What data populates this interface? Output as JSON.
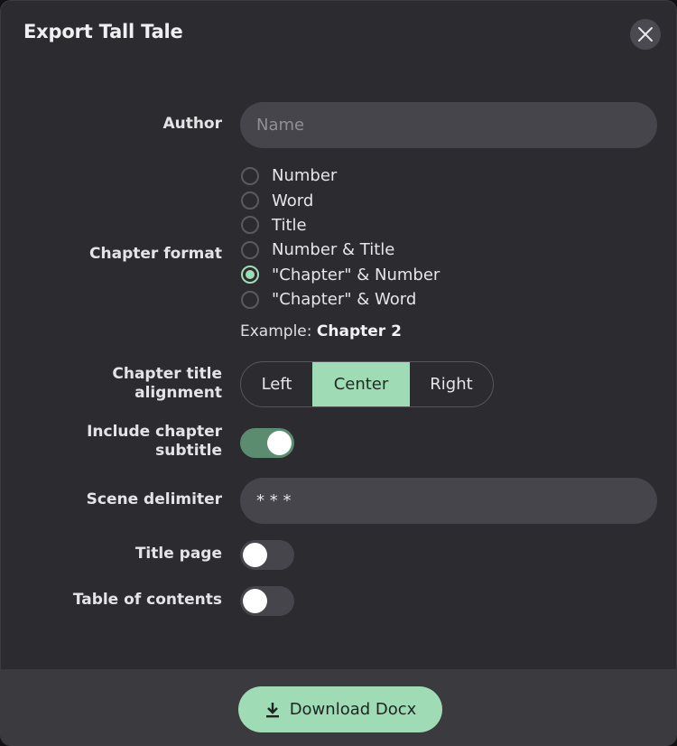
{
  "dialog": {
    "title": "Export Tall Tale",
    "close_icon": "close-icon"
  },
  "author": {
    "label": "Author",
    "value": "",
    "placeholder": "Name"
  },
  "chapter_format": {
    "label": "Chapter format",
    "options": [
      "Number",
      "Word",
      "Title",
      "Number & Title",
      "\"Chapter\" & Number",
      "\"Chapter\" & Word"
    ],
    "selected": "\"Chapter\" & Number",
    "example_prefix": "Example:",
    "example_value": "Chapter 2"
  },
  "alignment": {
    "label_line1": "Chapter title",
    "label_line2": "alignment",
    "options": [
      "Left",
      "Center",
      "Right"
    ],
    "selected": "Center"
  },
  "subtitle": {
    "label_line1": "Include chapter",
    "label_line2": "subtitle",
    "enabled": true
  },
  "scene_delimiter": {
    "label": "Scene delimiter",
    "value": "* * *"
  },
  "title_page": {
    "label": "Title page",
    "enabled": false
  },
  "toc": {
    "label": "Table of contents",
    "enabled": false
  },
  "footer": {
    "download_label": "Download Docx",
    "download_icon": "download-icon"
  },
  "colors": {
    "accent": "#9fdcb5",
    "dialog_bg": "#2c2c30",
    "input_bg": "#45454b",
    "toggle_on": "#5b8c6f",
    "footer_bg": "#3a3a3f"
  }
}
